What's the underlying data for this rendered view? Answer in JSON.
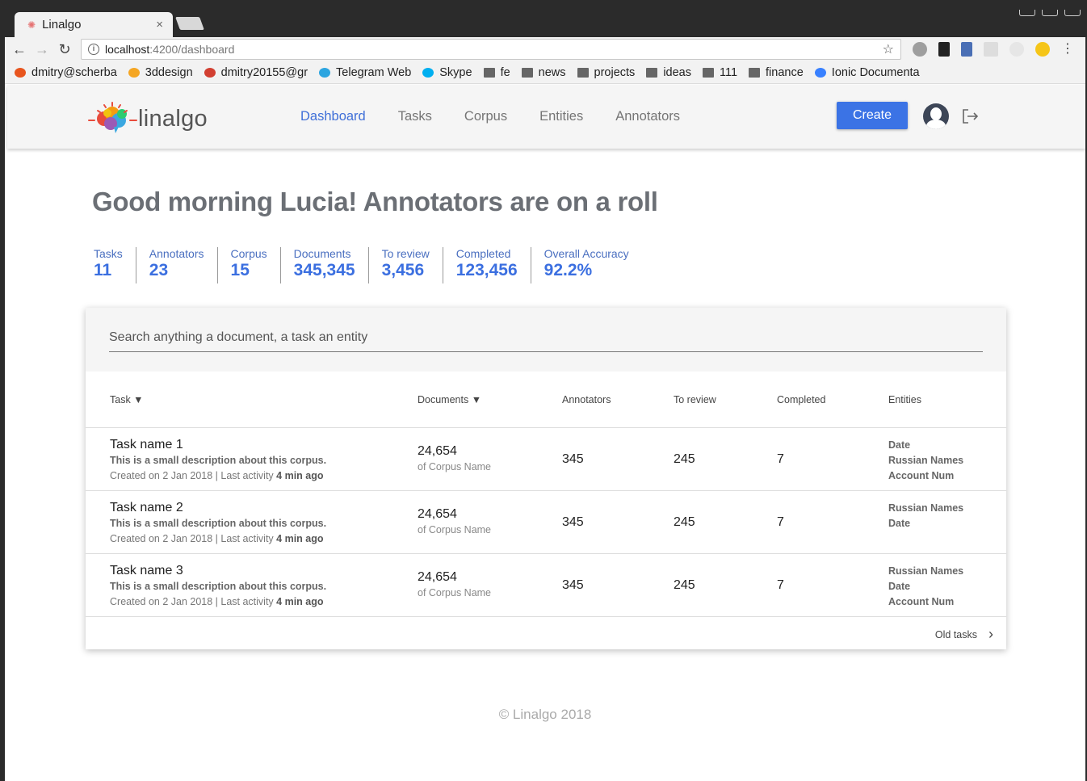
{
  "browser": {
    "tab_title": "Linalgo",
    "url_host": "localhost",
    "url_path": ":4200/dashboard",
    "bookmarks": [
      {
        "label": "dmitry@scherba",
        "icon": "cp-icon",
        "color": "#e8551e"
      },
      {
        "label": "3ddesign",
        "icon": "3d-icon",
        "color": "#f5a623"
      },
      {
        "label": "dmitry20155@gr",
        "icon": "gmail-icon",
        "color": "#d23f31"
      },
      {
        "label": "Telegram Web",
        "icon": "telegram-icon",
        "color": "#2ca5e0"
      },
      {
        "label": "Skype",
        "icon": "skype-icon",
        "color": "#00aff0"
      },
      {
        "label": "fe",
        "icon": "folder-icon",
        "color": "#666666"
      },
      {
        "label": "news",
        "icon": "folder-icon",
        "color": "#666666"
      },
      {
        "label": "projects",
        "icon": "folder-icon",
        "color": "#666666"
      },
      {
        "label": "ideas",
        "icon": "folder-icon",
        "color": "#666666"
      },
      {
        "label": "111",
        "icon": "folder-icon",
        "color": "#666666"
      },
      {
        "label": "finance",
        "icon": "folder-icon",
        "color": "#666666"
      },
      {
        "label": "Ionic Documenta",
        "icon": "ionic-icon",
        "color": "#3880ff"
      }
    ]
  },
  "app": {
    "brand": "linalgo",
    "nav": [
      {
        "label": "Dashboard",
        "active": true
      },
      {
        "label": "Tasks",
        "active": false
      },
      {
        "label": "Corpus",
        "active": false
      },
      {
        "label": "Entities",
        "active": false
      },
      {
        "label": "Annotators",
        "active": false
      }
    ],
    "create_label": "Create",
    "accent": "#3b73e5"
  },
  "greeting": "Good morning Lucia! Annotators are on a roll",
  "stats": [
    {
      "label": "Tasks",
      "value": "11"
    },
    {
      "label": "Annotators",
      "value": "23"
    },
    {
      "label": "Corpus",
      "value": "15"
    },
    {
      "label": "Documents",
      "value": "345,345"
    },
    {
      "label": "To review",
      "value": "3,456"
    },
    {
      "label": "Completed",
      "value": "123,456"
    },
    {
      "label": "Overall Accuracy",
      "value": "92.2%"
    }
  ],
  "search": {
    "placeholder": "Search anything a document, a task an entity"
  },
  "table": {
    "headers": {
      "task": "Task ▼",
      "documents": "Documents ▼",
      "annotators": "Annotators",
      "to_review": "To review",
      "completed": "Completed",
      "entities": "Entities"
    },
    "rows": [
      {
        "name": "Task name 1",
        "description": "This is a small description about this corpus.",
        "created": "Created on 2 Jan 2018 | Last activity ",
        "activity": "4 min ago",
        "documents": "24,654",
        "corpus": "of Corpus Name",
        "annotators": "345",
        "to_review": "245",
        "completed": "7",
        "entities": [
          "Date",
          "Russian Names",
          "Account Num"
        ]
      },
      {
        "name": "Task name 2",
        "description": "This is a small description about this corpus.",
        "created": "Created on 2 Jan 2018 | Last activity ",
        "activity": "4 min ago",
        "documents": "24,654",
        "corpus": "of Corpus Name",
        "annotators": "345",
        "to_review": "245",
        "completed": "7",
        "entities": [
          "Russian Names",
          "Date"
        ]
      },
      {
        "name": "Task name 3",
        "description": "This is a small description about this corpus.",
        "created": "Created on 2 Jan 2018 | Last activity ",
        "activity": "4 min ago",
        "documents": "24,654",
        "corpus": "of Corpus Name",
        "annotators": "345",
        "to_review": "245",
        "completed": "7",
        "entities": [
          "Russian Names",
          "Date",
          "Account Num"
        ]
      }
    ],
    "old_tasks_label": "Old tasks"
  },
  "footer": "© Linalgo 2018"
}
